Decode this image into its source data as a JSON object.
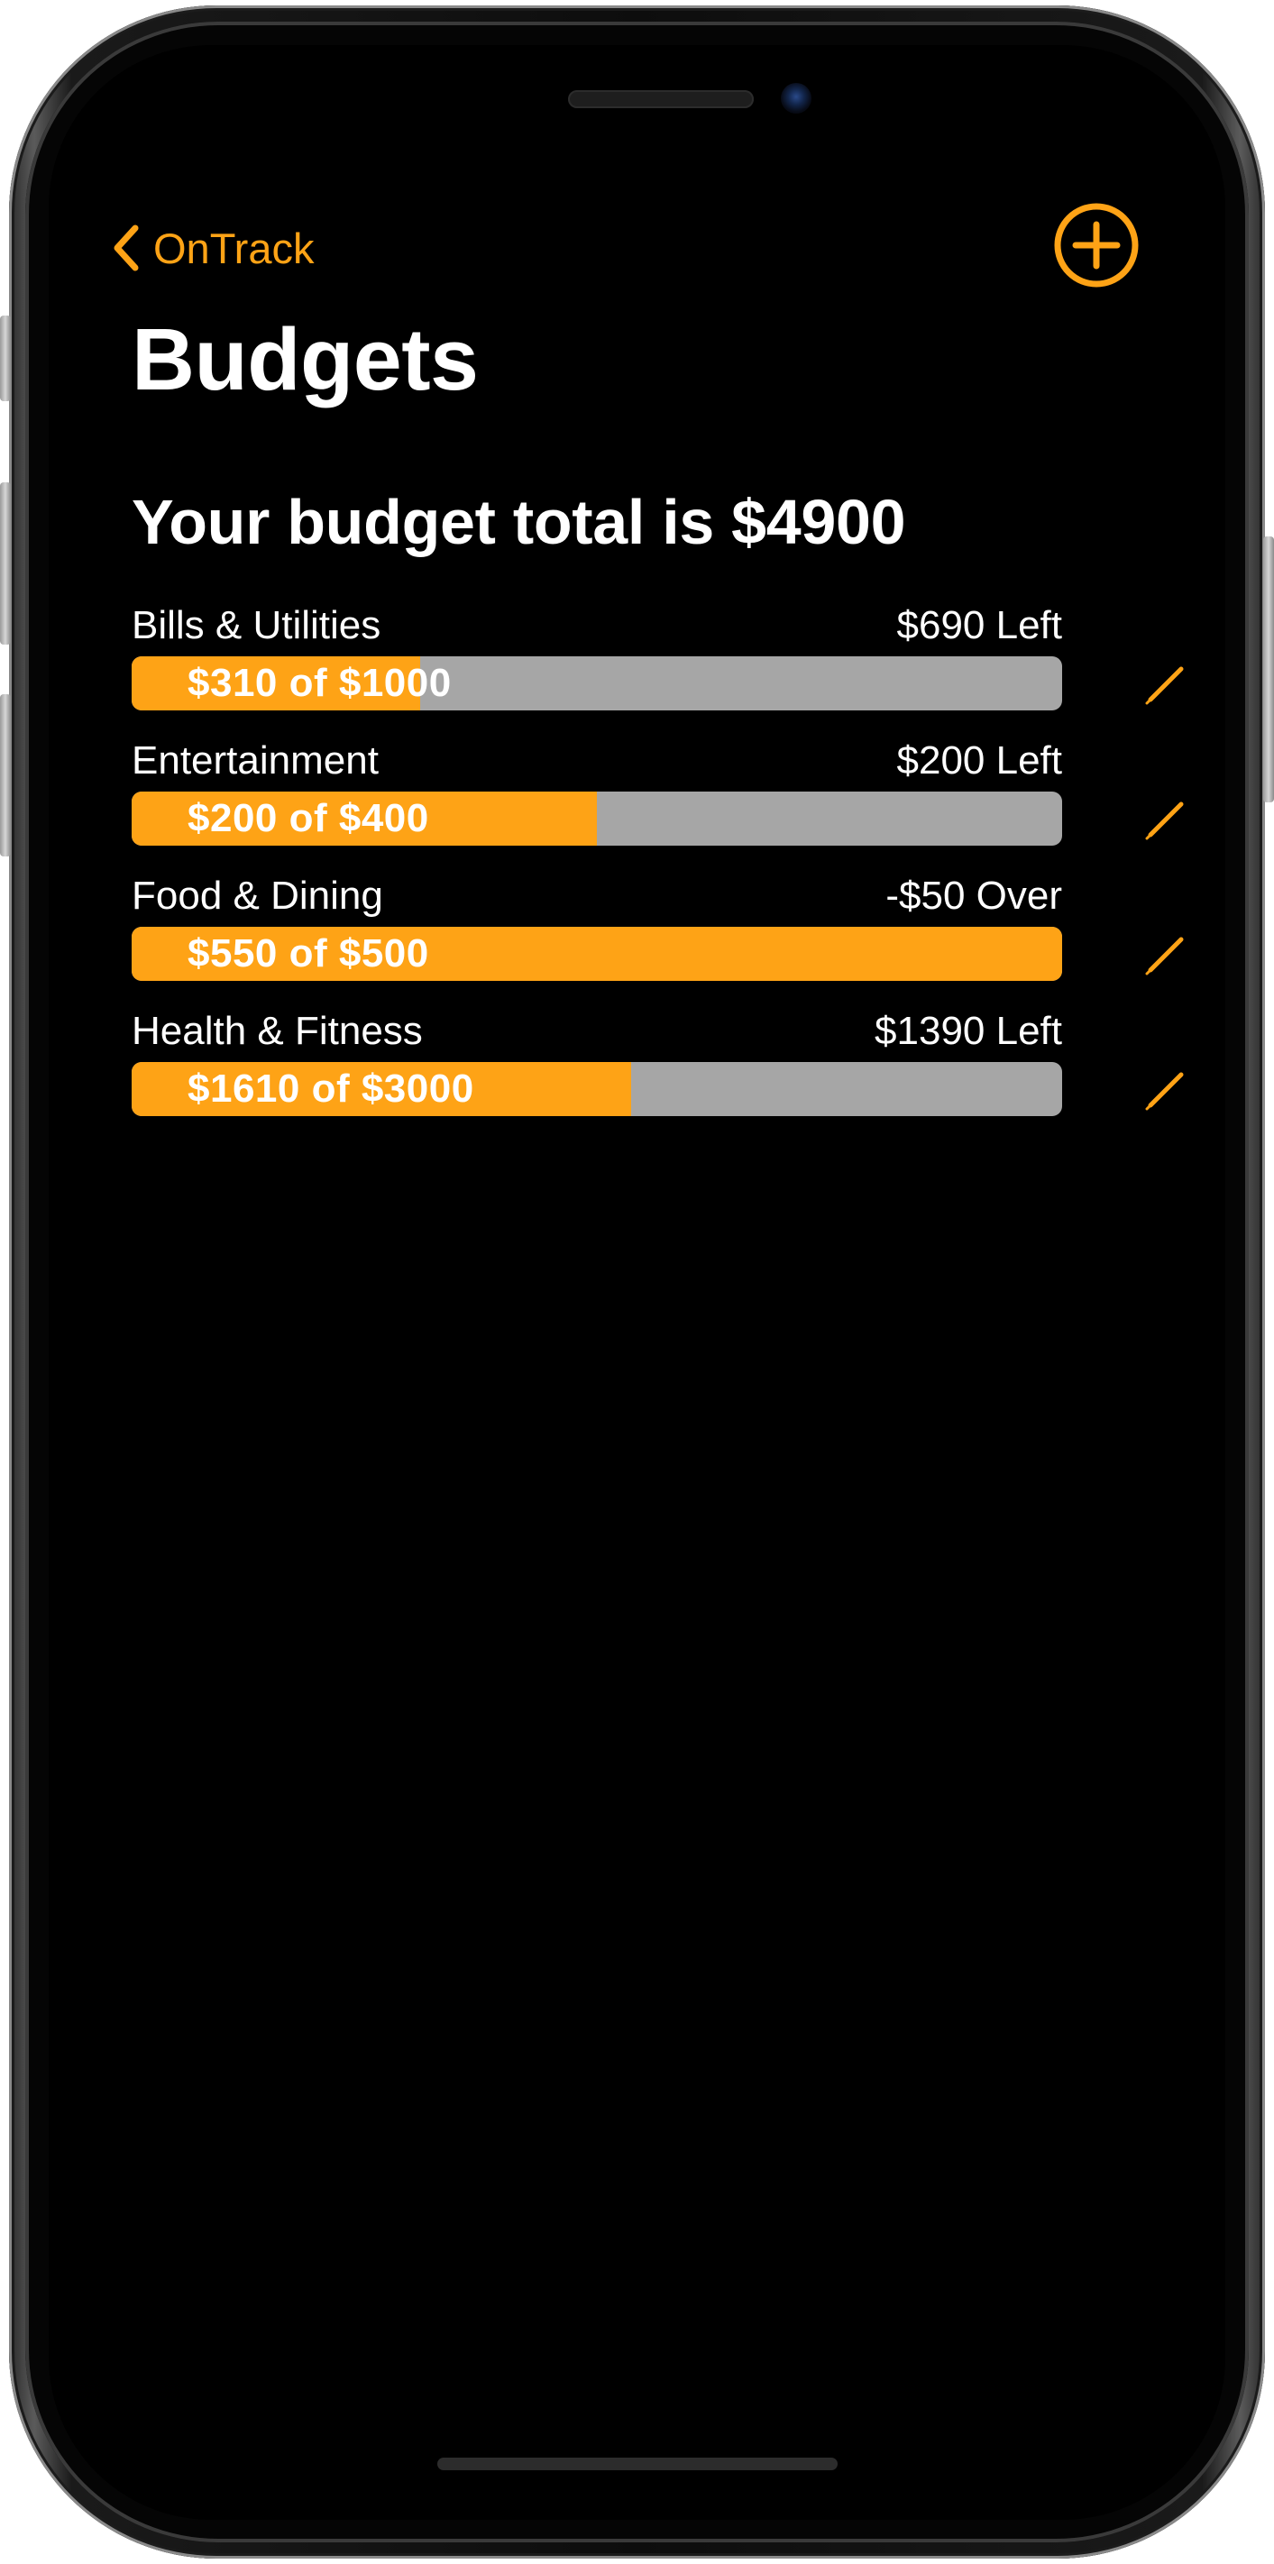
{
  "theme": {
    "accent": "#fea316",
    "background": "#000000",
    "bar_track": "#a6a6a6",
    "text": "#ffffff"
  },
  "nav": {
    "back_label": "OnTrack",
    "back_icon": "chevron-left-icon",
    "add_icon": "plus-circle-icon"
  },
  "page": {
    "title": "Budgets",
    "total_text": "Your budget total is $4900"
  },
  "budgets": [
    {
      "name": "Bills & Utilities",
      "status": "$690 Left",
      "progress_text": "$310 of $1000",
      "spent": 310,
      "limit": 1000,
      "edit_icon": "pencil-icon"
    },
    {
      "name": "Entertainment",
      "status": "$200 Left",
      "progress_text": "$200 of $400",
      "spent": 200,
      "limit": 400,
      "edit_icon": "pencil-icon"
    },
    {
      "name": "Food & Dining",
      "status": "-$50 Over",
      "progress_text": "$550 of $500",
      "spent": 550,
      "limit": 500,
      "edit_icon": "pencil-icon"
    },
    {
      "name": "Health & Fitness",
      "status": "$1390 Left",
      "progress_text": "$1610 of $3000",
      "spent": 1610,
      "limit": 3000,
      "edit_icon": "pencil-icon"
    }
  ]
}
